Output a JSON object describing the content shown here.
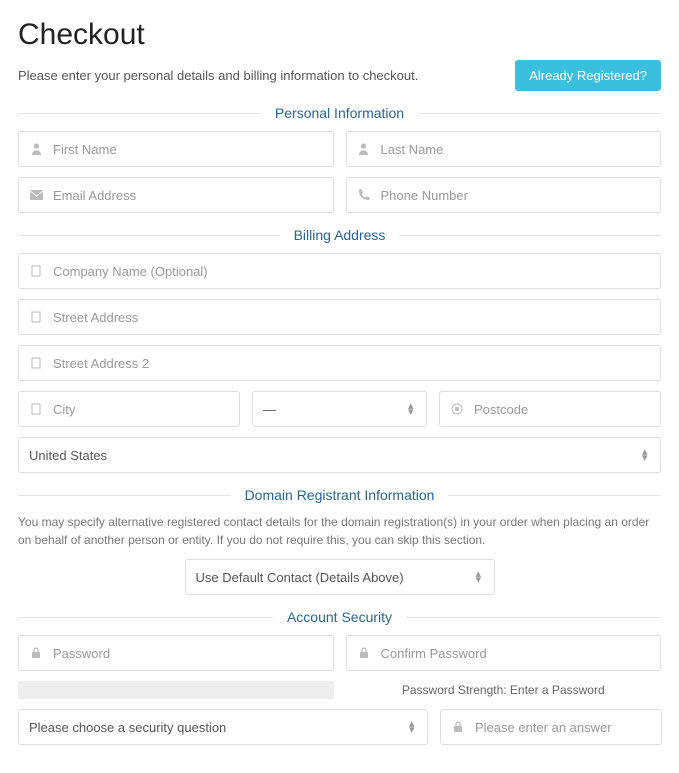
{
  "header": {
    "title": "Checkout",
    "subtitle": "Please enter your personal details and billing information to checkout.",
    "already_registered": "Already Registered?"
  },
  "sections": {
    "personal": "Personal Information",
    "billing": "Billing Address",
    "domain_registrant": "Domain Registrant Information",
    "account_security": "Account Security"
  },
  "personal": {
    "first_name": "First Name",
    "last_name": "Last Name",
    "email": "Email Address",
    "phone": "Phone Number"
  },
  "billing": {
    "company": "Company Name (Optional)",
    "street1": "Street Address",
    "street2": "Street Address 2",
    "city": "City",
    "state_placeholder": "—",
    "postcode": "Postcode",
    "country": "United States"
  },
  "domain_registrant": {
    "help": "You may specify alternative registered contact details for the domain registration(s) in your order when placing an order on behalf of another person or entity. If you do not require this, you can skip this section.",
    "select_value": "Use Default Contact (Details Above)"
  },
  "security": {
    "password": "Password",
    "confirm": "Confirm Password",
    "strength_label": "Password Strength: Enter a Password",
    "question": "Please choose a security question",
    "answer": "Please enter an answer"
  }
}
